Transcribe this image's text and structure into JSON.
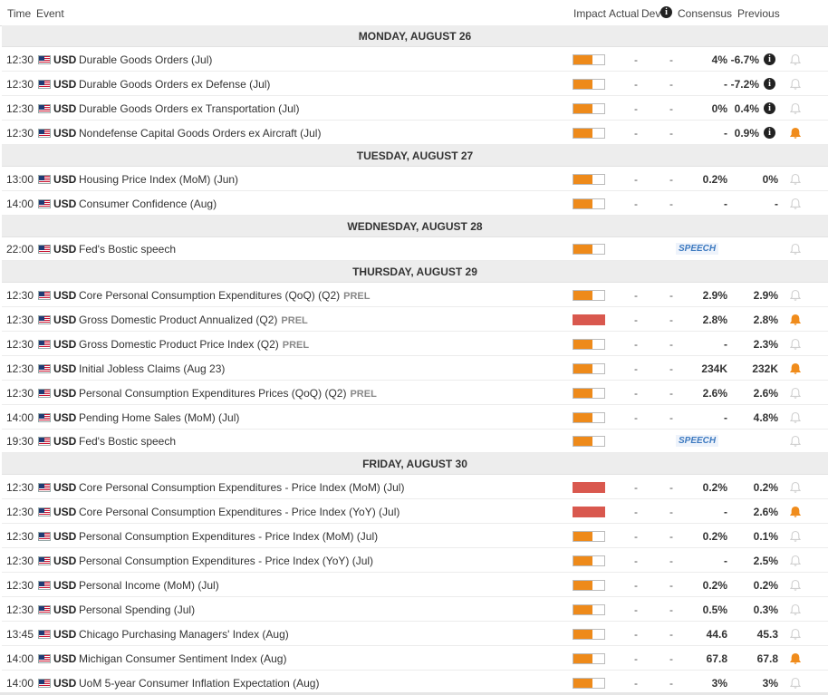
{
  "header": {
    "time": "Time",
    "event": "Event",
    "impact": "Impact",
    "actual": "Actual",
    "dev": "Dev",
    "consensus": "Consensus",
    "previous": "Previous",
    "info_glyph": "i"
  },
  "glyphs": {
    "dash": "-",
    "info": "i"
  },
  "colors": {
    "medium": "#ee8a1a",
    "high": "#d9584e",
    "bell_active": "#f08c1c",
    "bell_inactive": "#d0d0d0",
    "speech": "#3d7ac0"
  },
  "days": [
    {
      "label": "MONDAY, AUGUST 26",
      "events": [
        {
          "time": "12:30",
          "currency": "USD",
          "name": "Durable Goods Orders (Jul)",
          "tag": "",
          "impact": "medium",
          "consensus": "4%",
          "previous": "-6.7%",
          "info": true,
          "bell": false
        },
        {
          "time": "12:30",
          "currency": "USD",
          "name": "Durable Goods Orders ex Defense (Jul)",
          "tag": "",
          "impact": "medium",
          "consensus": "-",
          "previous": "-7.2%",
          "info": true,
          "bell": false
        },
        {
          "time": "12:30",
          "currency": "USD",
          "name": "Durable Goods Orders ex Transportation (Jul)",
          "tag": "",
          "impact": "medium",
          "consensus": "0%",
          "previous": "0.4%",
          "info": true,
          "bell": false
        },
        {
          "time": "12:30",
          "currency": "USD",
          "name": "Nondefense Capital Goods Orders ex Aircraft (Jul)",
          "tag": "",
          "impact": "medium",
          "consensus": "-",
          "previous": "0.9%",
          "info": true,
          "bell": true
        }
      ]
    },
    {
      "label": "TUESDAY, AUGUST 27",
      "events": [
        {
          "time": "13:00",
          "currency": "USD",
          "name": "Housing Price Index (MoM) (Jun)",
          "tag": "",
          "impact": "medium",
          "consensus": "0.2%",
          "previous": "0%",
          "info": false,
          "bell": false
        },
        {
          "time": "14:00",
          "currency": "USD",
          "name": "Consumer Confidence (Aug)",
          "tag": "",
          "impact": "medium",
          "consensus": "-",
          "previous": "-",
          "info": false,
          "bell": false
        }
      ]
    },
    {
      "label": "WEDNESDAY, AUGUST 28",
      "events": [
        {
          "time": "22:00",
          "currency": "USD",
          "name": "Fed's Bostic speech",
          "tag": "",
          "impact": "medium",
          "speech": "SPEECH",
          "info": false,
          "bell": false
        }
      ]
    },
    {
      "label": "THURSDAY, AUGUST 29",
      "events": [
        {
          "time": "12:30",
          "currency": "USD",
          "name": "Core Personal Consumption Expenditures (QoQ) (Q2)",
          "tag": "PREL",
          "impact": "medium",
          "consensus": "2.9%",
          "previous": "2.9%",
          "info": false,
          "bell": false
        },
        {
          "time": "12:30",
          "currency": "USD",
          "name": "Gross Domestic Product Annualized (Q2)",
          "tag": "PREL",
          "impact": "high",
          "consensus": "2.8%",
          "previous": "2.8%",
          "info": false,
          "bell": true
        },
        {
          "time": "12:30",
          "currency": "USD",
          "name": "Gross Domestic Product Price Index (Q2)",
          "tag": "PREL",
          "impact": "medium",
          "consensus": "-",
          "previous": "2.3%",
          "info": false,
          "bell": false
        },
        {
          "time": "12:30",
          "currency": "USD",
          "name": "Initial Jobless Claims (Aug 23)",
          "tag": "",
          "impact": "medium",
          "consensus": "234K",
          "previous": "232K",
          "info": false,
          "bell": true
        },
        {
          "time": "12:30",
          "currency": "USD",
          "name": "Personal Consumption Expenditures Prices (QoQ) (Q2)",
          "tag": "PREL",
          "impact": "medium",
          "consensus": "2.6%",
          "previous": "2.6%",
          "info": false,
          "bell": false
        },
        {
          "time": "14:00",
          "currency": "USD",
          "name": "Pending Home Sales (MoM) (Jul)",
          "tag": "",
          "impact": "medium",
          "consensus": "-",
          "previous": "4.8%",
          "info": false,
          "bell": false
        },
        {
          "time": "19:30",
          "currency": "USD",
          "name": "Fed's Bostic speech",
          "tag": "",
          "impact": "medium",
          "speech": "SPEECH",
          "info": false,
          "bell": false
        }
      ]
    },
    {
      "label": "FRIDAY, AUGUST 30",
      "events": [
        {
          "time": "12:30",
          "currency": "USD",
          "name": "Core Personal Consumption Expenditures - Price Index (MoM) (Jul)",
          "tag": "",
          "impact": "high",
          "consensus": "0.2%",
          "previous": "0.2%",
          "info": false,
          "bell": false
        },
        {
          "time": "12:30",
          "currency": "USD",
          "name": "Core Personal Consumption Expenditures - Price Index (YoY) (Jul)",
          "tag": "",
          "impact": "high",
          "consensus": "-",
          "previous": "2.6%",
          "info": false,
          "bell": true
        },
        {
          "time": "12:30",
          "currency": "USD",
          "name": "Personal Consumption Expenditures - Price Index (MoM) (Jul)",
          "tag": "",
          "impact": "medium",
          "consensus": "0.2%",
          "previous": "0.1%",
          "info": false,
          "bell": false
        },
        {
          "time": "12:30",
          "currency": "USD",
          "name": "Personal Consumption Expenditures - Price Index (YoY) (Jul)",
          "tag": "",
          "impact": "medium",
          "consensus": "-",
          "previous": "2.5%",
          "info": false,
          "bell": false
        },
        {
          "time": "12:30",
          "currency": "USD",
          "name": "Personal Income (MoM) (Jul)",
          "tag": "",
          "impact": "medium",
          "consensus": "0.2%",
          "previous": "0.2%",
          "info": false,
          "bell": false
        },
        {
          "time": "12:30",
          "currency": "USD",
          "name": "Personal Spending (Jul)",
          "tag": "",
          "impact": "medium",
          "consensus": "0.5%",
          "previous": "0.3%",
          "info": false,
          "bell": false
        },
        {
          "time": "13:45",
          "currency": "USD",
          "name": "Chicago Purchasing Managers' Index (Aug)",
          "tag": "",
          "impact": "medium",
          "consensus": "44.6",
          "previous": "45.3",
          "info": false,
          "bell": false
        },
        {
          "time": "14:00",
          "currency": "USD",
          "name": "Michigan Consumer Sentiment Index (Aug)",
          "tag": "",
          "impact": "medium",
          "consensus": "67.8",
          "previous": "67.8",
          "info": false,
          "bell": true
        },
        {
          "time": "14:00",
          "currency": "USD",
          "name": "UoM 5-year Consumer Inflation Expectation (Aug)",
          "tag": "",
          "impact": "medium",
          "consensus": "3%",
          "previous": "3%",
          "info": false,
          "bell": false
        }
      ]
    }
  ]
}
